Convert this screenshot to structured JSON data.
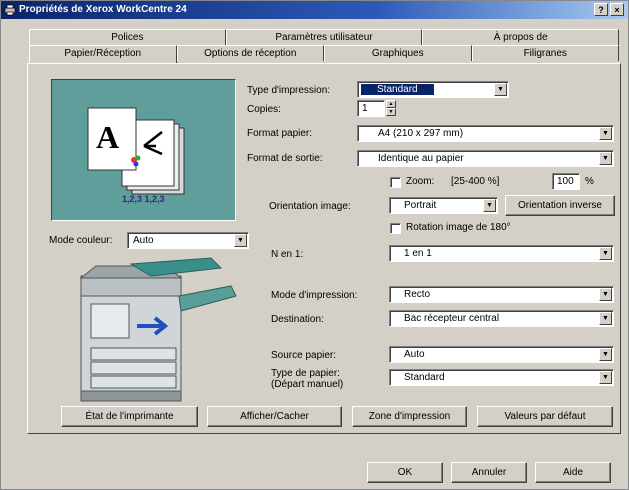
{
  "window": {
    "title": "Propriétés de Xerox WorkCentre 24",
    "help_label": "?",
    "close_label": "×"
  },
  "tabs": {
    "back": [
      "Polices",
      "Paramètres utilisateur",
      "À propos de"
    ],
    "front": [
      "Papier/Réception",
      "Options de réception",
      "Graphiques",
      "Filigranes"
    ],
    "active": "Papier/Réception"
  },
  "form": {
    "print_type": {
      "label": "Type d'impression:",
      "value": "Standard"
    },
    "copies": {
      "label": "Copies:",
      "value": "1"
    },
    "paper_size": {
      "label": "Format papier:",
      "value": "A4 (210 x 297 mm)"
    },
    "output_size": {
      "label": "Format de sortie:",
      "value": "Identique au papier"
    },
    "zoom": {
      "label": "Zoom:",
      "range": "[25-400 %]",
      "value": "100",
      "unit": "%"
    },
    "orientation": {
      "label": "Orientation image:",
      "value": "Portrait",
      "button": "Orientation inverse"
    },
    "rotate": {
      "label": "Rotation image de 180°"
    },
    "n_up": {
      "label": "N en 1:",
      "value": "1 en 1"
    },
    "color_mode": {
      "label": "Mode couleur:",
      "value": "Auto"
    },
    "print_mode": {
      "label": "Mode d'impression:",
      "value": "Recto"
    },
    "destination": {
      "label": "Destination:",
      "value": "Bac récepteur central"
    },
    "paper_source": {
      "label": "Source papier:",
      "value": "Auto"
    },
    "paper_type": {
      "label": "Type de papier:",
      "label2": "(Départ manuel)",
      "value": "Standard"
    }
  },
  "action_buttons": [
    "État de l'imprimante",
    "Afficher/Cacher",
    "Zone d'impression",
    "Valeurs par défaut"
  ],
  "dialog_buttons": [
    "OK",
    "Annuler",
    "Aide"
  ]
}
